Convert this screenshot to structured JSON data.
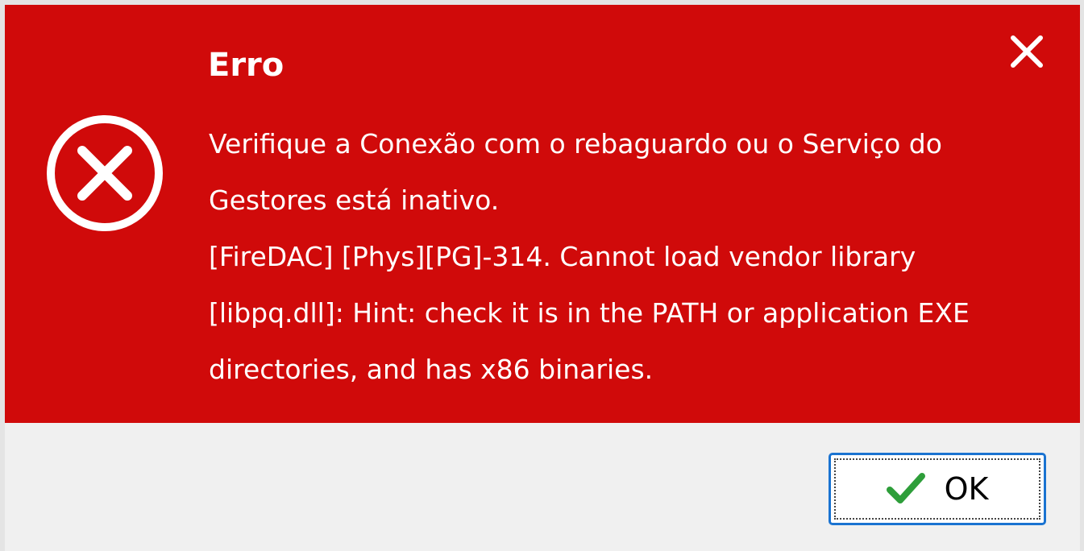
{
  "dialog": {
    "title": "Erro",
    "message_lines": [
      "Verifique a Conexão com o rebaguardo ou o Serviço do",
      "Gestores está inativo.",
      "[FireDAC] [Phys][PG]-314. Cannot load vendor library",
      "[libpq.dll]: Hint: check it is in the PATH or application EXE",
      "directories, and has x86 binaries."
    ],
    "icons": {
      "status": "error-circle-x-icon",
      "close": "close-icon",
      "ok": "checkmark-icon"
    },
    "ok_label": "OK"
  },
  "colors": {
    "header_background": "#d00a0a",
    "footer_background": "#f0f0f0",
    "text_on_header": "#ffffff",
    "ok_border": "#1a73d1",
    "checkmark": "#2e9e3a"
  }
}
